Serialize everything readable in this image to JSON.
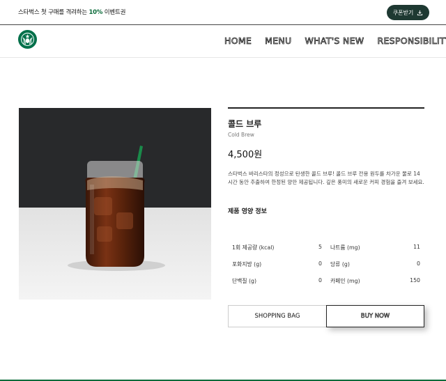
{
  "topbar": {
    "promo_before": "스타벅스 첫 구매를 격려하는 ",
    "promo_highlight": "10%",
    "promo_after": " 이벤트권",
    "coupon_label": "쿠폰받기"
  },
  "nav": {
    "items": [
      "HOME",
      "MENU",
      "WHAT'S NEW",
      "RESPONSIBILITY"
    ]
  },
  "product": {
    "name": "콜드 브루",
    "name_en": "Cold Brew",
    "price": "4,500원",
    "description": "스타벅스 바리스타의 정성으로 탄생한 콜드 브루! 콜드 브루 전용 원두를 차가운 물로 14시간 동안 추출하여 한정된 양만 제공됩니다. 깊은 풍미의 새로운 커피 경험을 즐겨 보세요.",
    "nutrition_title": "제품 영양 정보",
    "nutrition": [
      {
        "label1": "1회 제공량 (kcal)",
        "value1": "5",
        "label2": "나트륨 (mg)",
        "value2": "11"
      },
      {
        "label1": "포화지방 (g)",
        "value1": "0",
        "label2": "당류 (g)",
        "value2": "0"
      },
      {
        "label1": "단백질 (g)",
        "value1": "0",
        "label2": "카페인 (mg)",
        "value2": "150"
      }
    ]
  },
  "buttons": {
    "bag": "SHOPPING BAG",
    "buy": "BUY NOW"
  },
  "colors": {
    "brand_green": "#1e3932",
    "accent_green": "#0b6b3a"
  }
}
